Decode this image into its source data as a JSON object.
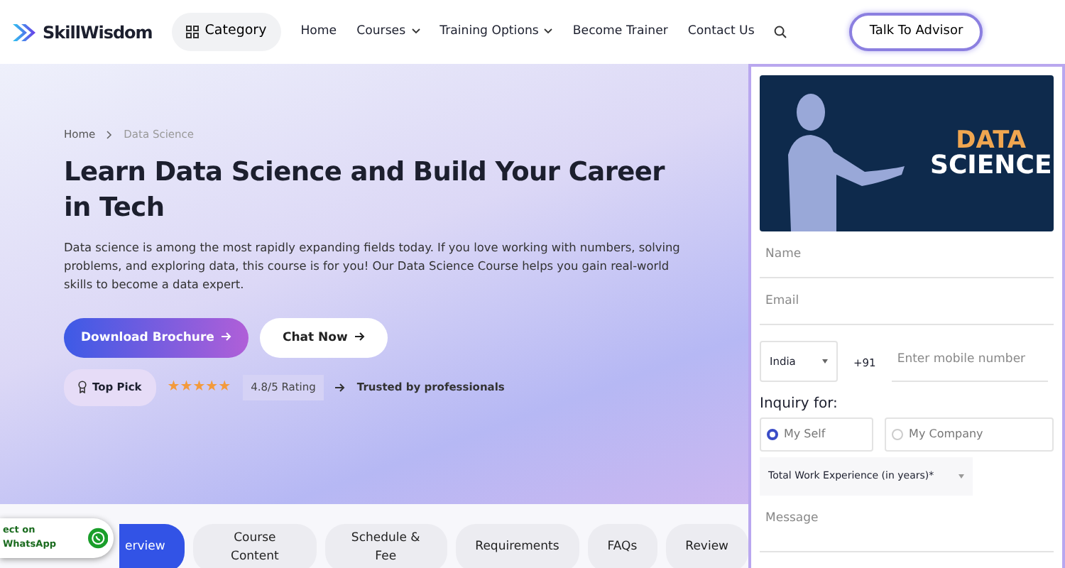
{
  "header": {
    "brand": "SkillWisdom",
    "category": "Category",
    "nav": [
      {
        "label": "Home",
        "dropdown": false
      },
      {
        "label": "Courses",
        "dropdown": true
      },
      {
        "label": "Training Options",
        "dropdown": true
      },
      {
        "label": "Become Trainer",
        "dropdown": false
      },
      {
        "label": "Contact Us",
        "dropdown": false
      }
    ],
    "cta": "Talk To Advisor"
  },
  "breadcrumb": [
    "Home",
    "Data Science"
  ],
  "hero": {
    "title": "Learn Data Science and Build Your Career in Tech",
    "text": "Data science is among the most rapidly expanding fields today. If you love working with numbers, solving problems, and exploring data, this course is for you! Our Data Science Course helps you gain real-world skills to become a data expert.",
    "buttons": [
      "Download Brochure",
      "Chat Now"
    ],
    "badge": "Top Pick",
    "stars": 5,
    "rating": "4.8/5 Rating",
    "trusted": "Trusted by professionals"
  },
  "tabs": [
    {
      "label": "erview",
      "selected": true
    },
    {
      "label": "Course Content",
      "selected": false
    },
    {
      "label": "Schedule & Fee",
      "selected": false
    },
    {
      "label": "Requirements",
      "selected": false
    },
    {
      "label": "FAQs",
      "selected": false
    },
    {
      "label": "Review",
      "selected": false
    }
  ],
  "whatsapp": "ect on WhatsApp",
  "form": {
    "banner": [
      "DATA",
      "SCIENCE"
    ],
    "name": {
      "placeholder": "Name"
    },
    "email": {
      "placeholder": "Email"
    },
    "country": "India",
    "code": "+91",
    "mobile": {
      "placeholder": "Enter mobile number"
    },
    "inquiry_label": "Inquiry for:",
    "options": [
      {
        "label": "My Self",
        "selected": true
      },
      {
        "label": "My Company",
        "selected": false
      }
    ],
    "experience": "Total Work Experience (in years)*",
    "message": {
      "placeholder": "Message"
    }
  }
}
